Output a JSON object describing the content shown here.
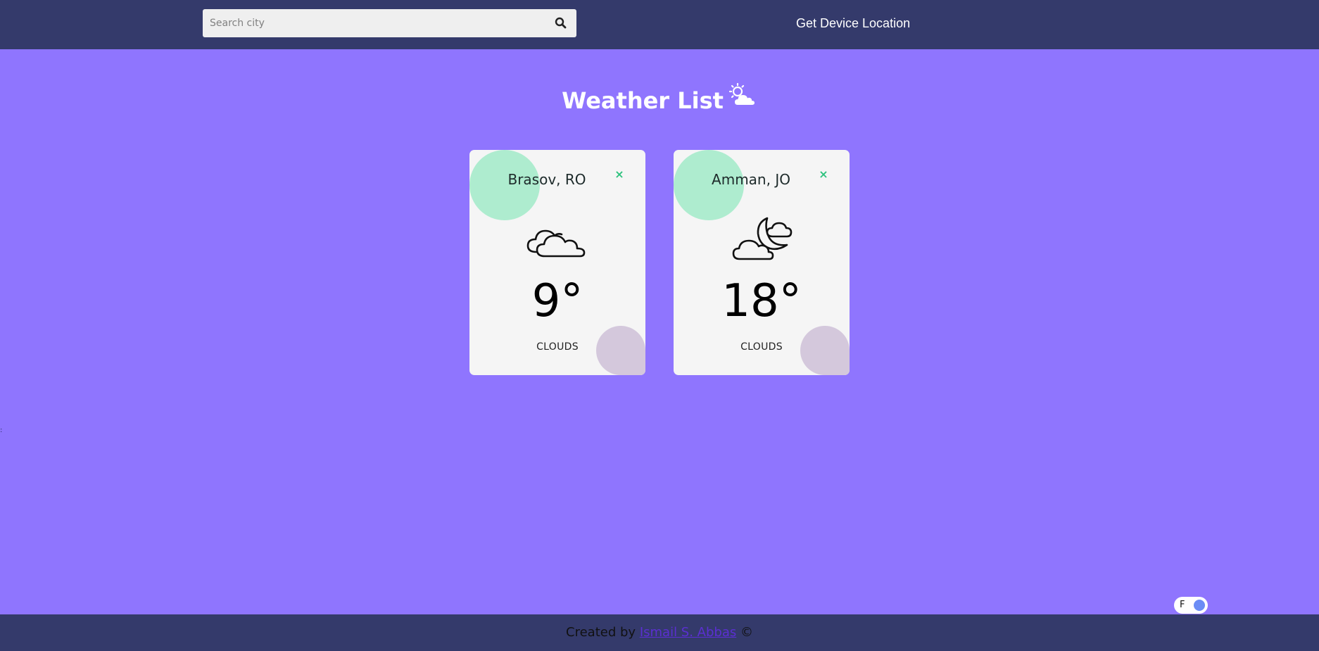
{
  "header": {
    "search_placeholder": "Search city",
    "search_icon": "search-icon",
    "device_location_label": "Get Device Location"
  },
  "page": {
    "title": "Weather List",
    "title_icon": "sun-cloud-icon"
  },
  "cards": [
    {
      "city": "Brasov, RO",
      "close_label": "×",
      "icon": "clouds-icon",
      "temperature": "9°",
      "description": "CLOUDS"
    },
    {
      "city": "Amman, JO",
      "close_label": "×",
      "icon": "moon-clouds-icon",
      "temperature": "18°",
      "description": "CLOUDS"
    }
  ],
  "left_mark": ":",
  "unit_toggle": {
    "label": "F"
  },
  "footer": {
    "prefix": "Created by",
    "author_link": "Ismail S. Abbas",
    "suffix": "©"
  },
  "colors": {
    "background": "#8f75fe",
    "bars": "#343a6b",
    "card": "#f5f5f5",
    "accent_green": "#2ec27e",
    "blob_green": "#aeeccf",
    "blob_mauve": "#d4c8dc",
    "toggle_knob": "#6b8cf5"
  }
}
